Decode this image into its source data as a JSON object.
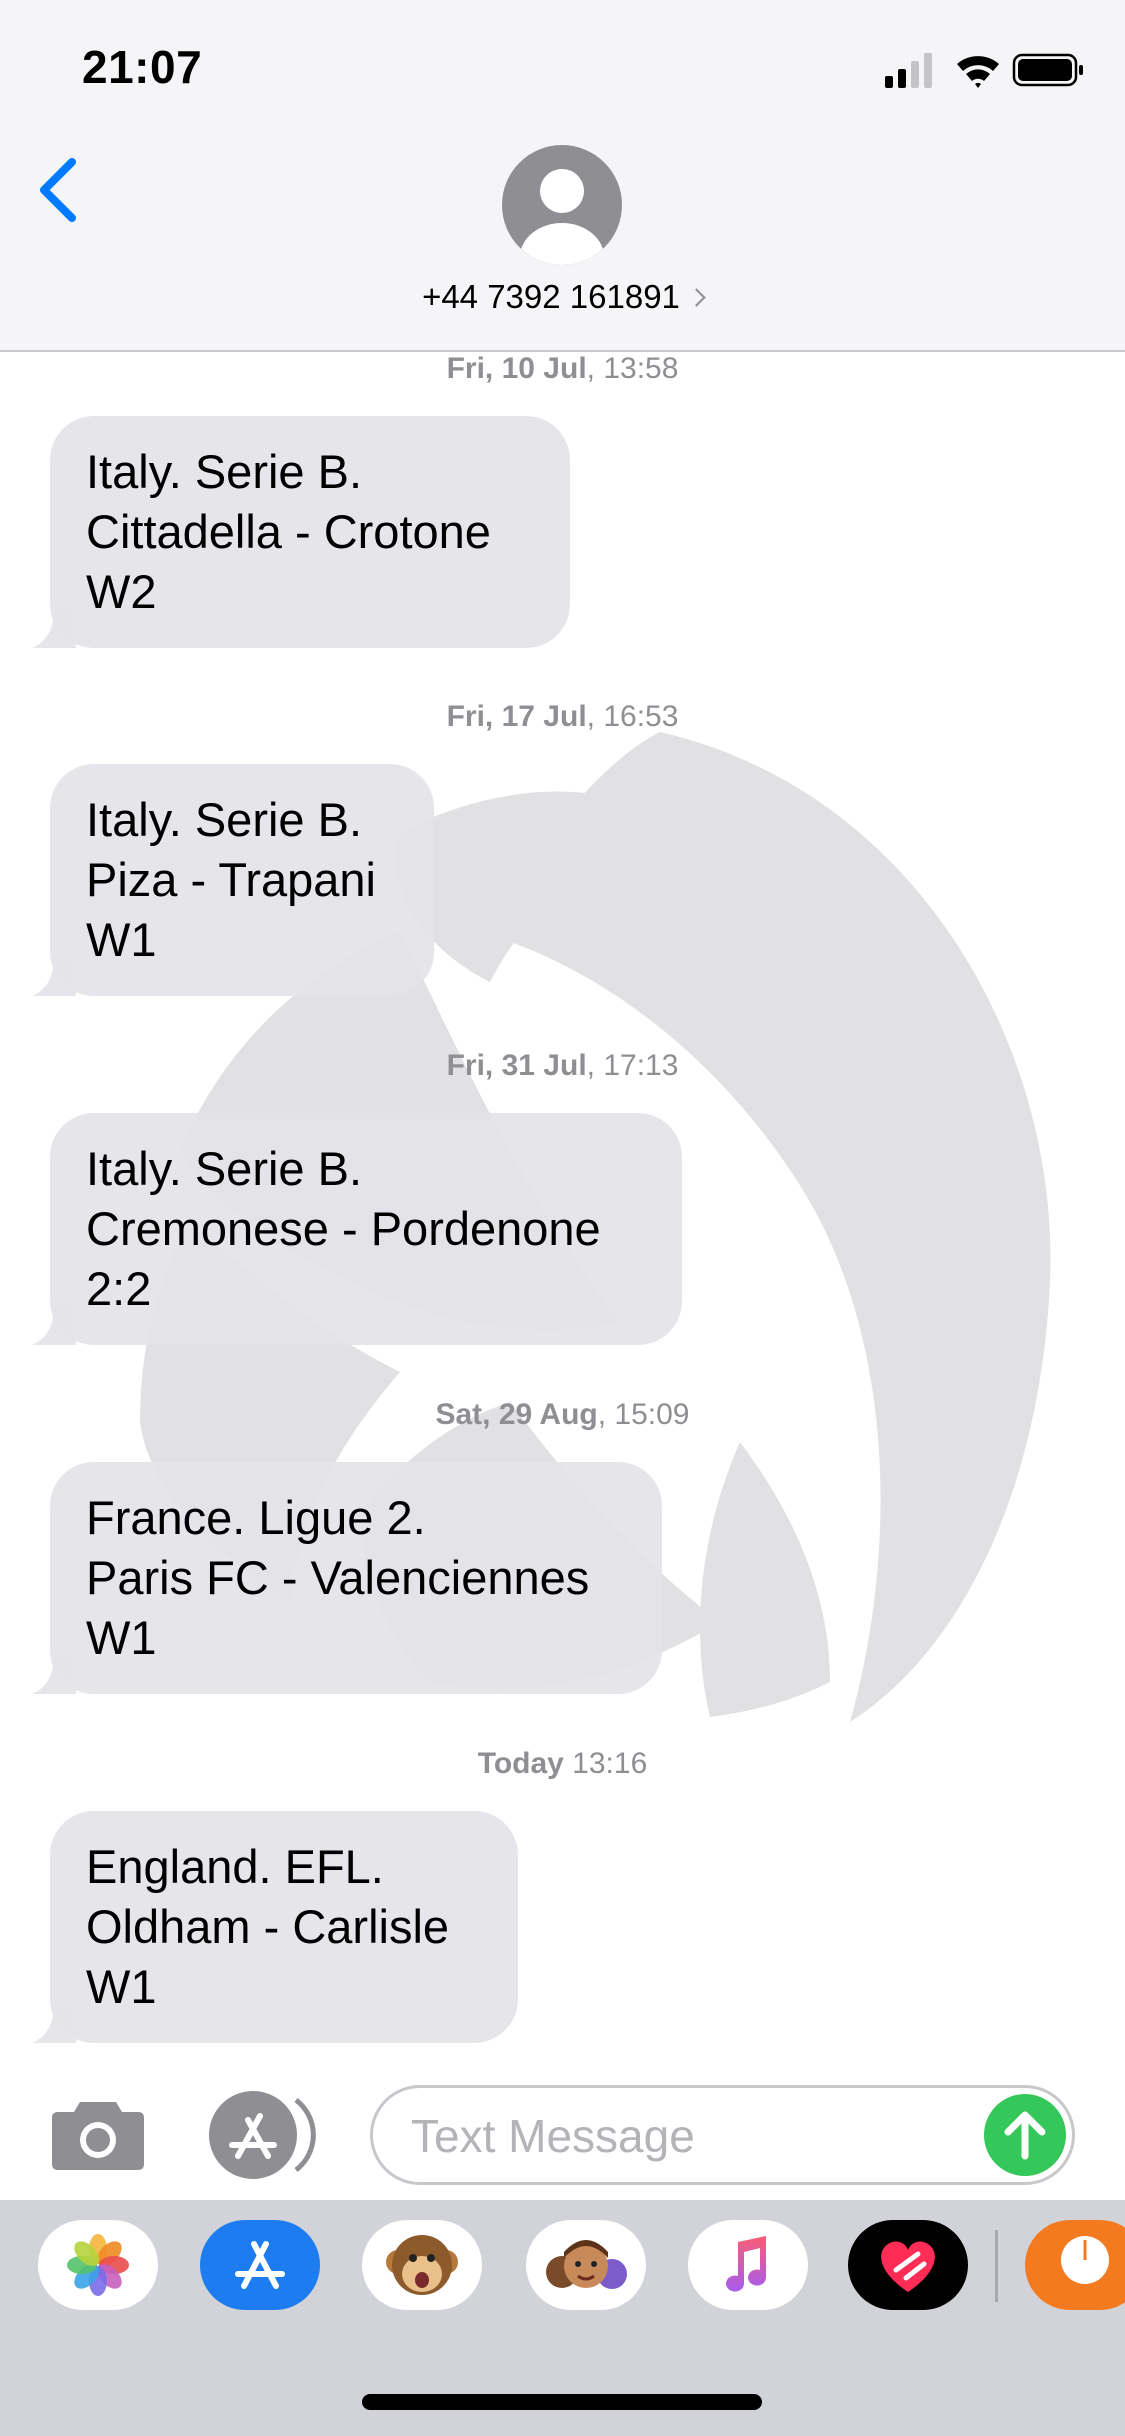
{
  "status_bar": {
    "time": "21:07"
  },
  "header": {
    "contact": "+44 7392 161891"
  },
  "conversation": {
    "messages": [
      {
        "date_bold": "Fri, 10 Jul",
        "time": ", 13:58",
        "lines": [
          "Italy. Serie B.",
          "Cittadella - Crotone",
          "W2"
        ]
      },
      {
        "date_bold": "Fri, 17 Jul",
        "time": ", 16:53",
        "lines": [
          "Italy. Serie B.",
          "Piza - Trapani",
          "W1"
        ]
      },
      {
        "date_bold": "Fri, 31 Jul",
        "time": ", 17:13",
        "lines": [
          "Italy. Serie B.",
          "Cremonese - Pordenone",
          "2:2"
        ]
      },
      {
        "date_bold": "Sat, 29 Aug",
        "time": ", 15:09",
        "lines": [
          "France. Ligue 2.",
          "Paris FC - Valenciennes",
          "W1"
        ]
      },
      {
        "date_bold": "Today",
        "time": " 13:16",
        "lines": [
          "England. EFL.",
          "Oldham - Carlisle",
          "W1"
        ]
      }
    ]
  },
  "compose": {
    "placeholder": "Text Message"
  },
  "colors": {
    "accent": "#007aff",
    "send": "#34c759",
    "bubble": "#e4e4e8",
    "timestamp": "#8e8e93"
  },
  "app_drawer": {
    "apps": [
      "photos-app",
      "app-store-app",
      "animoji-app",
      "memoji-app",
      "music-app",
      "digital-touch-app",
      "partial-app"
    ]
  }
}
